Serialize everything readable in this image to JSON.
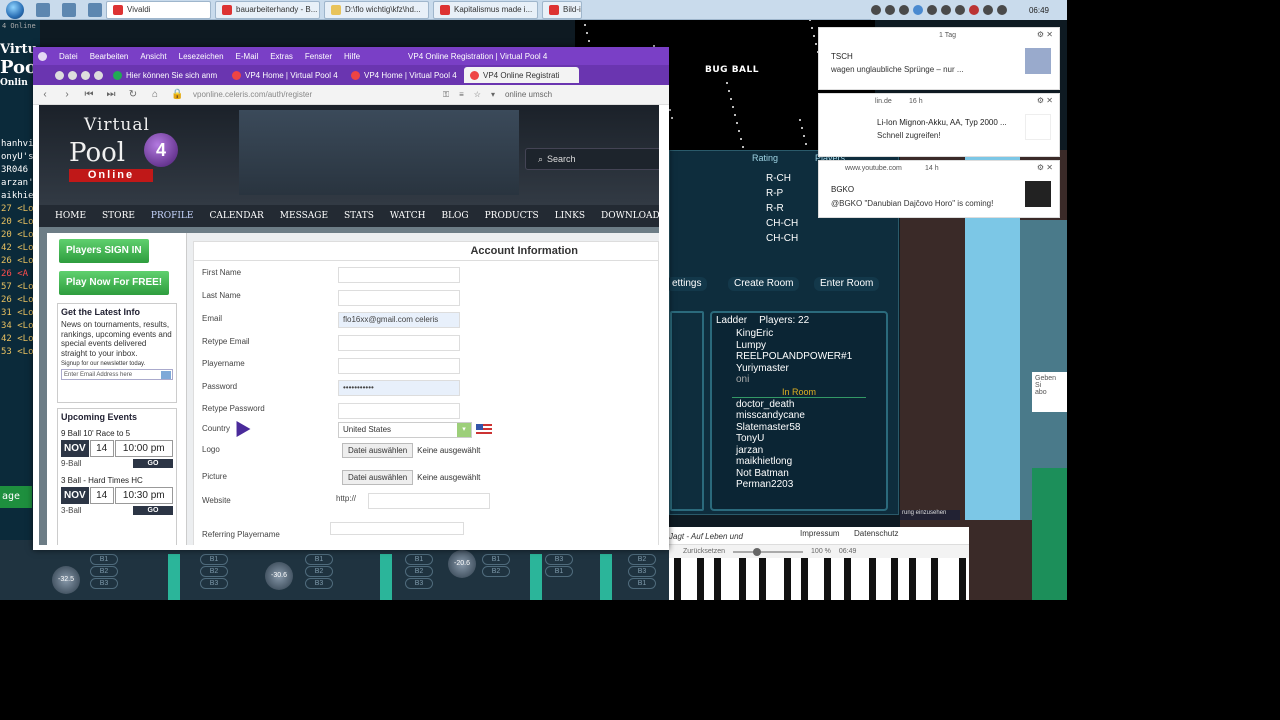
{
  "taskbar": {
    "tasks": [
      {
        "label": "Vivaldi",
        "active": true
      },
      {
        "label": "bauarbeiterhandy - B..."
      },
      {
        "label": "D:\\flo wichtig\\kfz\\hd..."
      },
      {
        "label": "Kapitalismus made i..."
      },
      {
        "label": "Bild-in"
      }
    ],
    "clock": "06:49"
  },
  "left_app": {
    "title": "4 Online",
    "logo_top": "Virtu",
    "logo_mid": "Pool",
    "logo_bottom": "Onlin",
    "rows": [
      {
        "t": "hanhvi",
        "c": "w"
      },
      {
        "t": "onyU's",
        "c": "w"
      },
      {
        "t": "3R046",
        "c": "w"
      },
      {
        "t": "arzan's",
        "c": "w"
      },
      {
        "t": "aikhie",
        "c": "w"
      },
      {
        "t": "27 <Lo",
        "c": ""
      },
      {
        "t": "20 <Lo",
        "c": ""
      },
      {
        "t": "20 <Lo",
        "c": ""
      },
      {
        "t": "42 <Lo",
        "c": ""
      },
      {
        "t": "26 <Lo",
        "c": ""
      },
      {
        "t": "26 <A",
        "c": "red"
      },
      {
        "t": "57 <Lo",
        "c": ""
      },
      {
        "t": "26 <Lo",
        "c": ""
      },
      {
        "t": "31 <Lo",
        "c": ""
      },
      {
        "t": "34 <Lo",
        "c": ""
      },
      {
        "t": "42 <Lo",
        "c": ""
      },
      {
        "t": "53 <Lo",
        "c": ""
      }
    ],
    "button": "age"
  },
  "browser": {
    "menu": [
      "Datei",
      "Bearbeiten",
      "Ansicht",
      "Lesezeichen",
      "E-Mail",
      "Extras",
      "Fenster",
      "Hilfe"
    ],
    "window_title": "VP4 Online Registration | Virtual Pool 4",
    "tabs": [
      {
        "label": "Hier können Sie sich anm"
      },
      {
        "label": "VP4 Home | Virtual Pool 4"
      },
      {
        "label": "VP4 Home | Virtual Pool 4"
      },
      {
        "label": "VP4 Online Registrati",
        "active": true
      }
    ],
    "url": "vponline.celeris.com/auth/register",
    "search_placeholder": "online umsch"
  },
  "site": {
    "logo_virtual": "Virtual",
    "logo_pool": "Pool",
    "logo_num": "4",
    "logo_online": "Online",
    "search": "Search",
    "nav": [
      "HOME",
      "STORE",
      "PROFILE",
      "CALENDAR",
      "MESSAGE",
      "STATS",
      "WATCH",
      "BLOG",
      "PRODUCTS",
      "LINKS",
      "DOWNLOADS",
      "SUPPORT"
    ],
    "nav_active": "PROFILE"
  },
  "sidebar": {
    "signin": "Players SIGN IN",
    "play_free": "Play Now For FREE!",
    "latest_title": "Get the Latest Info",
    "latest_text": "News on tournaments, results, rankings, upcoming events and special events delivered straight to your inbox.",
    "signup_text": "Signup for our newsletter today.",
    "email_placeholder": "Enter Email Address here",
    "upcoming_title": "Upcoming Events",
    "events": [
      {
        "title": "9 Ball 10' Race to 5",
        "month": "NOV",
        "day": "14",
        "time": "10:00 pm",
        "type": "9-Ball",
        "go": "GO"
      },
      {
        "title": "3 Ball - Hard Times HC",
        "month": "NOV",
        "day": "14",
        "time": "10:30 pm",
        "type": "3-Ball",
        "go": "GO"
      }
    ]
  },
  "form": {
    "heading": "Account Information",
    "first_name": "First Name",
    "last_name": "Last Name",
    "email": "Email",
    "email_value": "flo16xx@gmail.com celeris",
    "retype_email": "Retype Email",
    "playername": "Playername",
    "password": "Password",
    "password_value": "•••••••••••",
    "retype_password": "Retype Password",
    "country": "Country",
    "country_value": "United States",
    "logo": "Logo",
    "picture": "Picture",
    "choose_file": "Datei auswählen",
    "no_file": "Keine ausgewählt",
    "website": "Website",
    "website_prefix": "http://",
    "referring": "Referring Playername"
  },
  "video": {
    "title": "BUG BALL"
  },
  "notifications": [
    {
      "src": "",
      "line1": "TSCH",
      "line2": "wagen unglaubliche Sprünge – nur ...",
      "meta": "1 Tag"
    },
    {
      "src": "lin.de",
      "line1": "Li-Ion Mignon-Akku, AA, Typ 2000 ...",
      "line2": "Schnell zugreifen!",
      "meta": "16 h"
    },
    {
      "src": "www.youtube.com",
      "line1": "BGKO",
      "line2": "@BGKO \"Danubian Dajčovo Horo\" is coming!",
      "meta": "14 h"
    }
  ],
  "game": {
    "rating_header": "Rating",
    "players_header": "Players",
    "ratings": [
      "R-CH",
      "R-P",
      "R-R",
      "CH-CH",
      "CH-CH"
    ],
    "settings": "ettings",
    "create_room": "Create Room",
    "enter_room": "Enter Room",
    "ladder_label": "Ladder",
    "players_label": "Players:",
    "players_count": "22",
    "ladder_players": [
      "KingEric",
      "Lumpy",
      "REELPOLANDPOWER#1",
      "Yuriymaster",
      "oni"
    ],
    "in_room_label": "In Room",
    "room_players": [
      "doctor_death",
      "misscandycane",
      "Slatemaster58",
      "TonyU",
      "jarzan",
      "maikhietlong",
      "Not Batman",
      "Perman2203"
    ]
  },
  "right_strip": {
    "tip": "Geben Si",
    "tip2": "abo",
    "caption": "rung einzusehen",
    "mute": "Mute"
  },
  "footer": {
    "song": "Jagt - Auf Leben und",
    "impressum": "Impressum",
    "datenschutz": "Datenschutz",
    "reset": "Zurücksetzen",
    "zoom": "100 %",
    "time": "06:49"
  },
  "mixer": {
    "knob1": "-32.5",
    "knob2": "-30.6",
    "knob3": "-20.6"
  }
}
